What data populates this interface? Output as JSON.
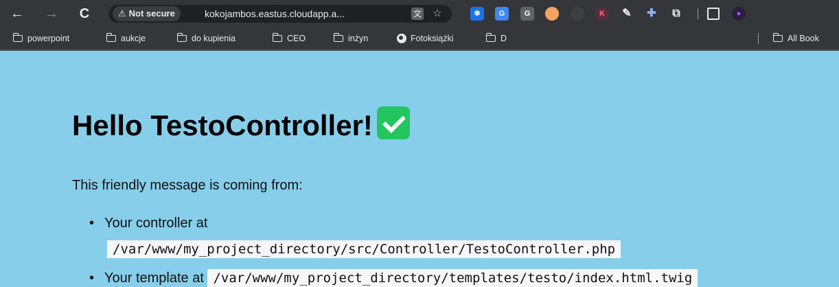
{
  "browser": {
    "nav": {
      "back": "←",
      "forward": "→",
      "reload": "C"
    },
    "security": {
      "icon": "⚠",
      "label": "Not secure"
    },
    "url": "kokojambos.eastus.cloudapp.a...",
    "icons": {
      "translate": "translate-icon",
      "bookmark_star": "star-icon"
    },
    "extensions": [
      "snowflake-extension",
      "translate-extension",
      "G",
      "eyes-extension",
      "circle-extension",
      "K",
      "pipette-extension",
      "badge-extension",
      "puzzle-extension"
    ],
    "bookmarks": [
      {
        "label": "powerpoint",
        "icon": "folder-icon"
      },
      {
        "label": "aukcje",
        "icon": "folder-icon"
      },
      {
        "label": "do kupienia",
        "icon": "folder-icon"
      },
      {
        "label": "CEO",
        "icon": "folder-icon"
      },
      {
        "label": "inżyn",
        "icon": "folder-icon"
      },
      {
        "label": "Fotoksiążki",
        "icon": "globe-icon"
      },
      {
        "label": "D",
        "icon": "folder-icon"
      }
    ],
    "all_bookmarks": "All Book"
  },
  "page": {
    "background": "#87ceeb",
    "title": "Hello TestoController!",
    "intro": "This friendly message is coming from:",
    "items": [
      {
        "label": "Your controller at",
        "path": "/var/www/my_project_directory/src/Controller/TestoController.php"
      },
      {
        "label": "Your template at",
        "path": "/var/www/my_project_directory/templates/testo/index.html.twig"
      }
    ]
  }
}
